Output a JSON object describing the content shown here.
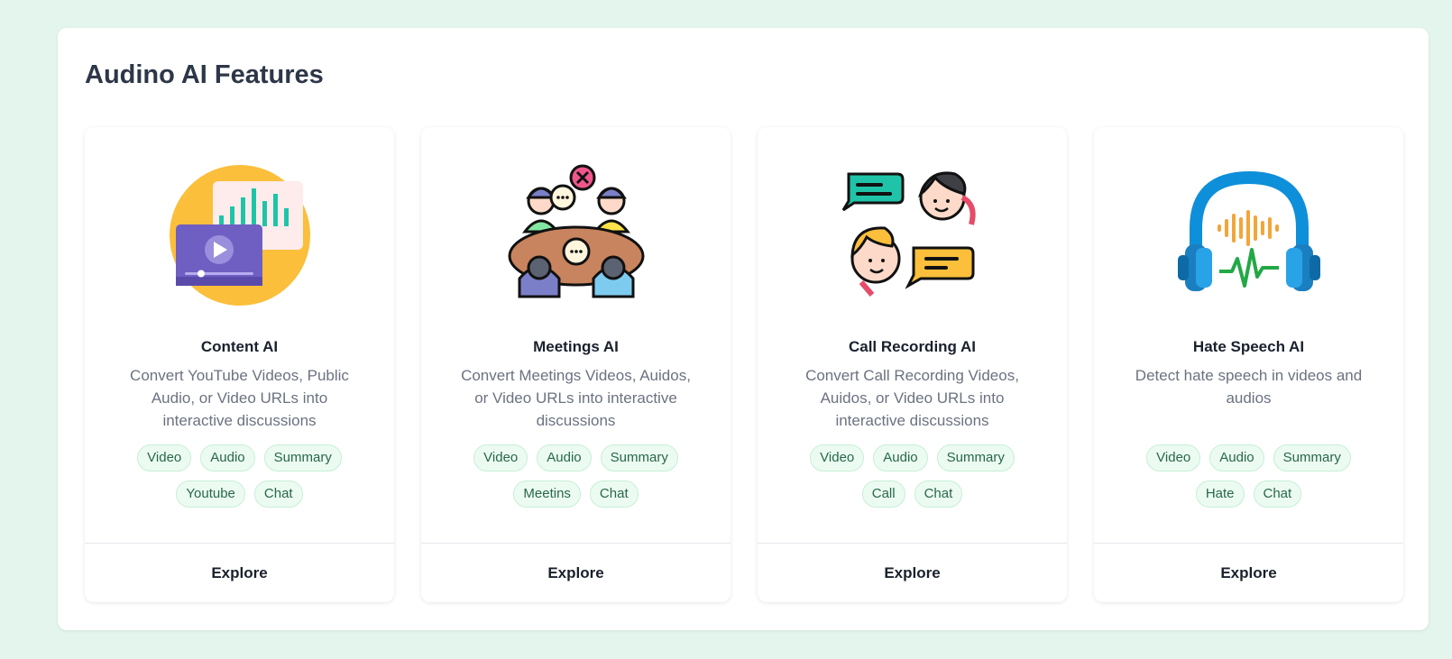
{
  "page": {
    "title": "Audino AI Features"
  },
  "cards": [
    {
      "title": "Content AI",
      "description": "Convert YouTube Videos, Public Audio, or Video URLs into interactive discussions",
      "tags": [
        "Video",
        "Audio",
        "Summary",
        "Youtube",
        "Chat"
      ],
      "action_label": "Explore",
      "icon": "content-ai-icon"
    },
    {
      "title": "Meetings AI",
      "description": "Convert Meetings Videos, Auidos, or Video URLs into interactive discussions",
      "tags": [
        "Video",
        "Audio",
        "Summary",
        "Meetins",
        "Chat"
      ],
      "action_label": "Explore",
      "icon": "meetings-ai-icon"
    },
    {
      "title": "Call Recording AI",
      "description": "Convert Call Recording Videos, Auidos, or Video URLs into interactive discussions",
      "tags": [
        "Video",
        "Audio",
        "Summary",
        "Call",
        "Chat"
      ],
      "action_label": "Explore",
      "icon": "call-recording-ai-icon"
    },
    {
      "title": "Hate Speech AI",
      "description": "Detect hate speech in videos and audios",
      "tags": [
        "Video",
        "Audio",
        "Summary",
        "Hate",
        "Chat"
      ],
      "action_label": "Explore",
      "icon": "hate-speech-ai-icon"
    }
  ],
  "colors": {
    "background": "#e3f5ec",
    "tag_bg": "#ecfbf2",
    "tag_text": "#276749",
    "tag_border": "#c6efd6"
  }
}
